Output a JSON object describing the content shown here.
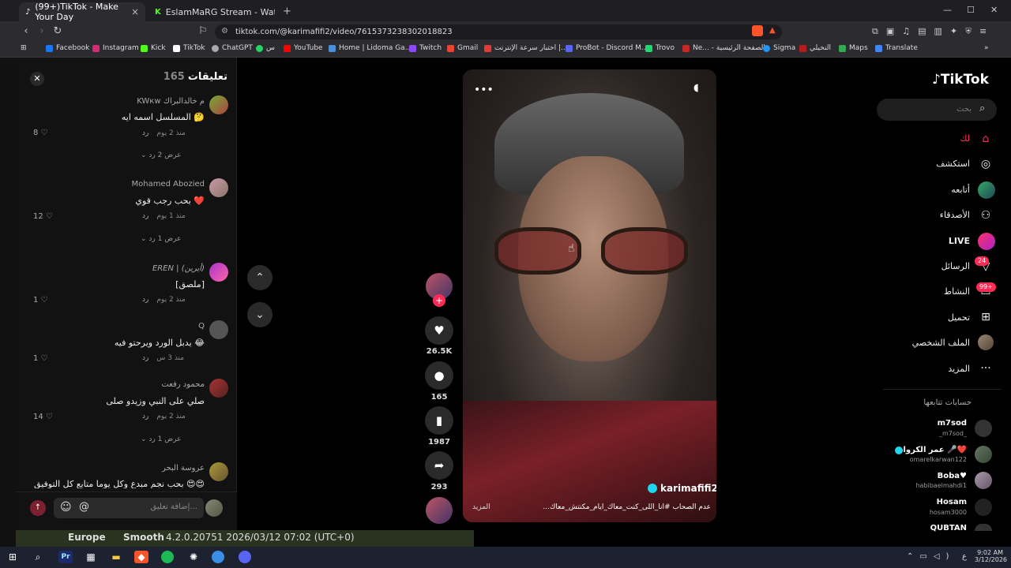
{
  "browser": {
    "tabs": [
      {
        "title": "(99+)TikTok - Make Your Day",
        "active": true
      },
      {
        "title": "EslamMaRG Stream - Watch Live on",
        "active": false
      }
    ],
    "url": "tiktok.com/@karimafifi2/video/7615373238302018823",
    "bookmarks": [
      "Facebook",
      "Instagram",
      "Kick",
      "TikTok",
      "ChatGPT",
      "س",
      "YouTube",
      "Home | Lidoma Ga...",
      "Twitch",
      "Gmail",
      "اختبار سرعة الإنترنت |...",
      "ProBot - Discord M...",
      "Trovo",
      "Ne... - الصفحة الرئيسية",
      "Sigma",
      "النخيلي",
      "Maps",
      "Translate"
    ]
  },
  "comments": {
    "title": "تعليقات",
    "count": "165",
    "items": [
      {
        "user": "KWкw م خالدالبراك",
        "text": "المسلسل اسمه ايه 🤔",
        "time": "منذ 2 يوم",
        "reply": "رد",
        "likes": "8",
        "view": "عرض 2 رد"
      },
      {
        "user": "Mohamed Abozied",
        "text": "بحب رجب قوي ❤️",
        "time": "منذ 1 يوم",
        "reply": "رد",
        "likes": "12",
        "view": "عرض 1 رد"
      },
      {
        "user": "EREN | (أيرين)",
        "text": "[ملصق]",
        "time": "منذ 2 يوم",
        "reply": "رد",
        "likes": "1",
        "view": ""
      },
      {
        "user": "Q",
        "text": "يدبل الورد ويرحتو فيه 😂",
        "time": "منذ 3 س",
        "reply": "رد",
        "likes": "1",
        "view": ""
      },
      {
        "user": "محمود رفعت",
        "text": "صلي على النبي وزيدو صلى",
        "time": "منذ 2 يوم",
        "reply": "رد",
        "likes": "14",
        "view": "عرض 1 رد"
      },
      {
        "user": "عروسة البحر",
        "text": "بحب نجم مبدع وكل يوما متابع كل التوفيق 😍😍",
        "time": "",
        "reply": "",
        "likes": "",
        "view": ""
      }
    ],
    "input_placeholder": "إضافة تعليق..."
  },
  "video": {
    "author": "karimafifi2",
    "caption": "...عدم الصحاب #انا_اللى_كنت_معاك_ايام_مكنتش_معاك",
    "more": "المزيد"
  },
  "actions": {
    "likes": "26.5K",
    "comments": "165",
    "saves": "1987",
    "shares": "293"
  },
  "sidebar": {
    "logo": "TikTok",
    "search_placeholder": "بحث",
    "nav": [
      {
        "label": "لك",
        "icon": "home-icon"
      },
      {
        "label": "استكشف",
        "icon": "compass-icon"
      },
      {
        "label": "أتابعه",
        "icon": "following-icon"
      },
      {
        "label": "الأصدقاء",
        "icon": "friends-icon"
      },
      {
        "label": "LIVE",
        "icon": "live-icon"
      },
      {
        "label": "الرسائل",
        "icon": "messages-icon",
        "badge": "24"
      },
      {
        "label": "النشاط",
        "icon": "activity-icon",
        "badge": "99+"
      },
      {
        "label": "تحميل",
        "icon": "upload-icon"
      },
      {
        "label": "الملف الشخصي",
        "icon": "profile-icon"
      },
      {
        "label": "المزيد",
        "icon": "more-icon"
      }
    ],
    "following_title": "حسابات تتابعها",
    "following": [
      {
        "name": "m7sod",
        "user": "_m7sod_"
      },
      {
        "name": "عمر الكروان 🎤❤️",
        "user": "omarelkarwan122"
      },
      {
        "name": "Boba♥",
        "user": "habibaelmahdi1"
      },
      {
        "name": "Hosam",
        "user": "hosam3000"
      },
      {
        "name": "QUBTAN",
        "user": ""
      }
    ]
  },
  "background": {
    "strip_text": "4.2.0.20751 2026/03/12 07:02 (UTC+0)",
    "region": "Europe",
    "mode": "Smooth"
  },
  "taskbar": {
    "time": "9:02 AM",
    "date": "3/12/2026",
    "lang": "ع"
  }
}
